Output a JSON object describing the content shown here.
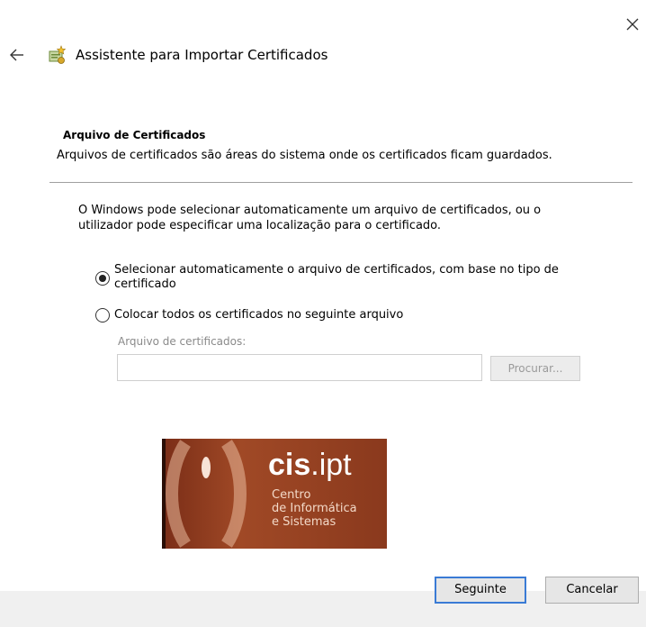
{
  "window": {
    "title": "Assistente para Importar Certificados",
    "close_icon": "close-icon",
    "back_icon": "back-arrow-icon",
    "wizard_icon": "certificate-wizard-icon"
  },
  "section": {
    "heading": "Arquivo de Certificados",
    "description": "Arquivos de certificados são áreas do sistema onde os certificados ficam guardados."
  },
  "intro": "O Windows pode selecionar automaticamente um arquivo de certificados, ou o utilizador pode especificar uma localização para o certificado.",
  "options": [
    {
      "label": "Selecionar automaticamente o arquivo de certificados, com base no tipo de certificado",
      "selected": true
    },
    {
      "label": "Colocar todos os certificados no seguinte arquivo",
      "selected": false
    }
  ],
  "store_field": {
    "label": "Arquivo de certificados:",
    "value": "",
    "browse_label": "Procurar..."
  },
  "logo": {
    "brand_bold": "cis",
    "brand_rest": ".ipt",
    "line1": "Centro",
    "line2": "de Informática",
    "line3": "e Sistemas"
  },
  "buttons": {
    "next": "Seguinte",
    "cancel": "Cancelar"
  },
  "colors": {
    "accent": "#3a7bd5",
    "logo_bg": "#8a391d"
  }
}
